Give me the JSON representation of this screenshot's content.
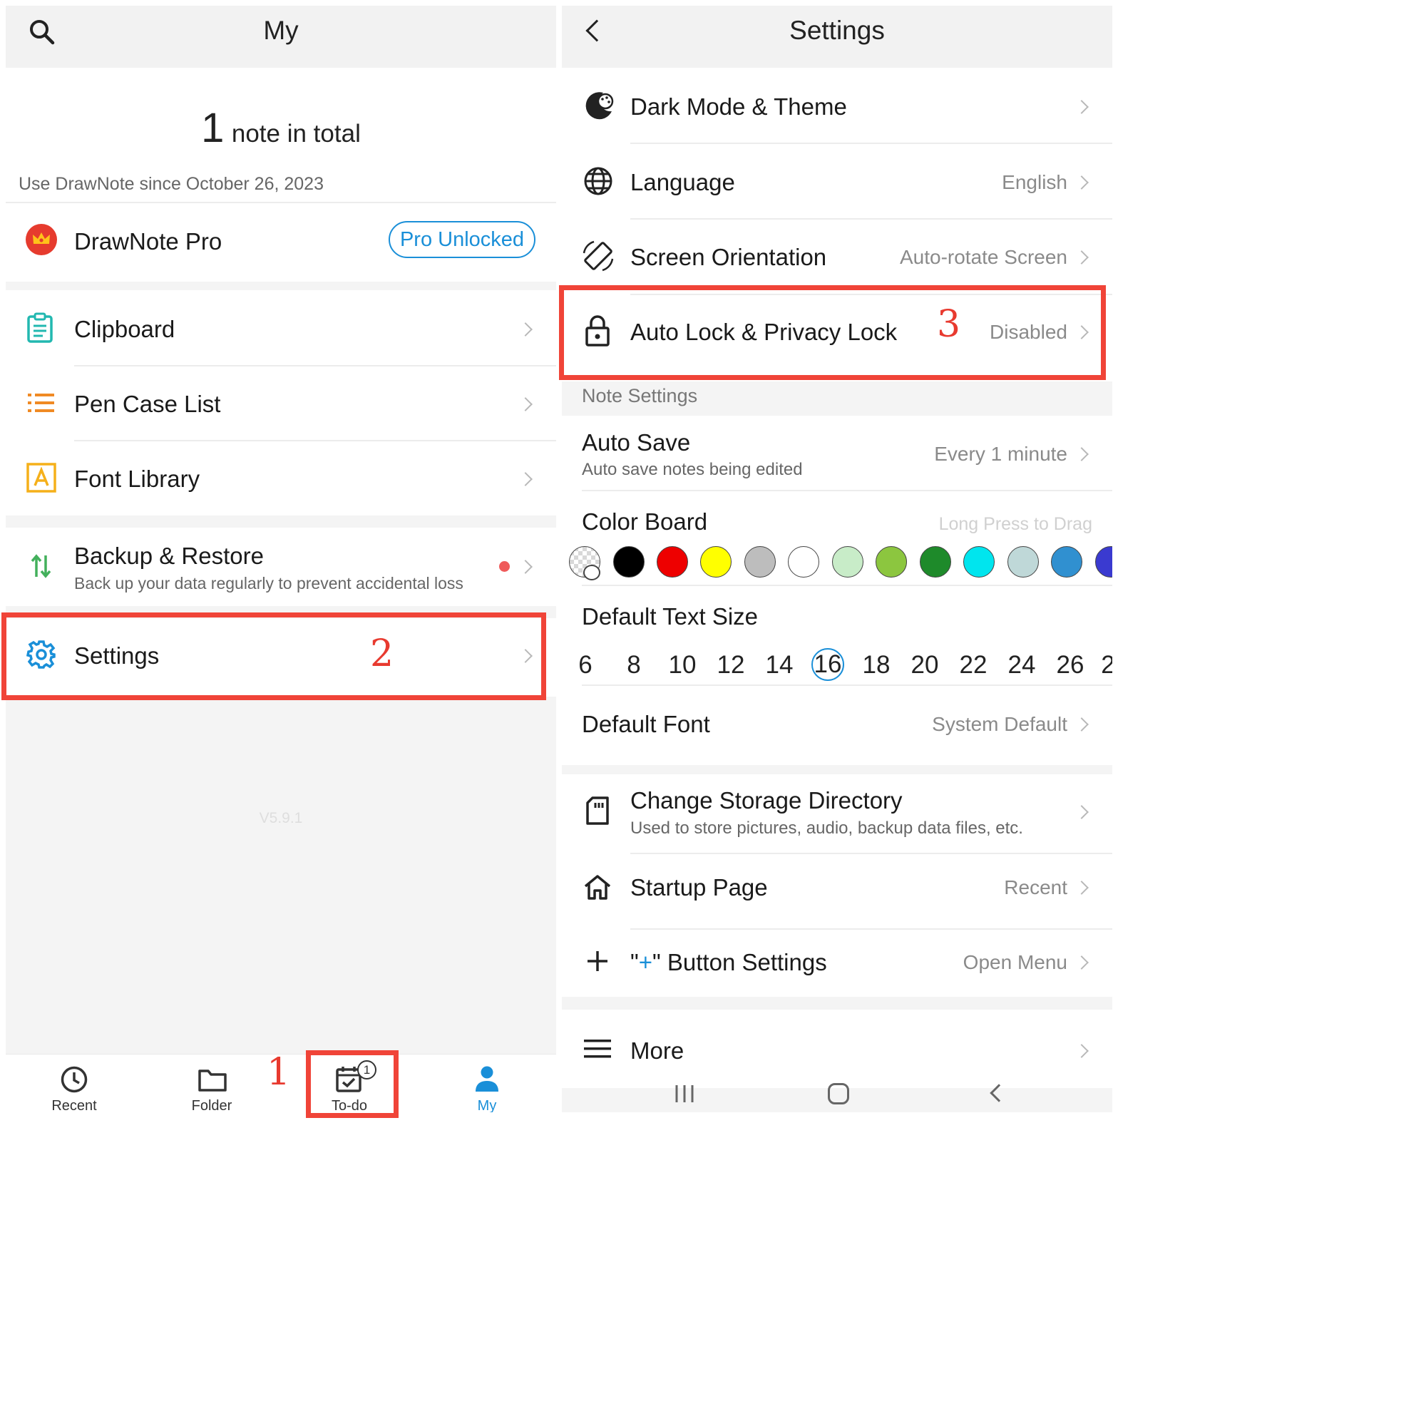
{
  "left": {
    "title": "My",
    "count_number": "1",
    "count_text": "note in total",
    "since": "Use DrawNote since October 26, 2023",
    "pro": {
      "label": "DrawNote Pro",
      "badge": "Pro Unlocked"
    },
    "menu": [
      {
        "label": "Clipboard",
        "icon": "clipboard-icon"
      },
      {
        "label": "Pen Case List",
        "icon": "list-icon"
      },
      {
        "label": "Font Library",
        "icon": "font-icon"
      }
    ],
    "backup": {
      "label": "Backup & Restore",
      "sub": "Back up your data regularly to prevent accidental loss"
    },
    "settings": {
      "label": "Settings",
      "icon": "gear-icon"
    },
    "version": "V5.9.1",
    "tabs": [
      {
        "label": "Recent",
        "icon": "clock-icon"
      },
      {
        "label": "Folder",
        "icon": "folder-icon"
      },
      {
        "label": "To-do",
        "icon": "calendar-check-icon",
        "badge": "1"
      },
      {
        "label": "My",
        "icon": "person-icon"
      }
    ]
  },
  "right": {
    "title": "Settings",
    "rows": [
      {
        "label": "Dark Mode & Theme",
        "value": "",
        "icon": "palette-moon-icon"
      },
      {
        "label": "Language",
        "value": "English",
        "icon": "globe-icon"
      },
      {
        "label": "Screen Orientation",
        "value": "Auto-rotate Screen",
        "icon": "rotate-icon"
      },
      {
        "label": "Auto Lock & Privacy Lock",
        "value": "Disabled",
        "icon": "lock-icon"
      }
    ],
    "note_settings_header": "Note Settings",
    "auto_save": {
      "label": "Auto Save",
      "sub": "Auto save notes being edited",
      "value": "Every 1 minute"
    },
    "color_board": {
      "label": "Color Board",
      "hint": "Long Press to Drag"
    },
    "colors": [
      "#000000",
      "#ee0000",
      "#ffff00",
      "#bdbdbd",
      "#ffffff",
      "#c8ecc8",
      "#8cc63f",
      "#1e8a2a",
      "#00e5ee",
      "#bfd8d8",
      "#3090d0",
      "#3a3ad0"
    ],
    "text_size": {
      "label": "Default Text Size",
      "sizes": [
        "6",
        "8",
        "10",
        "12",
        "14",
        "16",
        "18",
        "20",
        "22",
        "24",
        "26",
        "2"
      ],
      "selected": "16"
    },
    "default_font": {
      "label": "Default Font",
      "value": "System Default"
    },
    "storage": {
      "label": "Change Storage Directory",
      "sub": "Used to store pictures, audio, backup data files, etc."
    },
    "startup": {
      "label": "Startup Page",
      "value": "Recent"
    },
    "plus_button": {
      "q_open": "\"",
      "plus": "+",
      "q_close": "\"",
      "label": " Button Settings",
      "value": "Open Menu"
    },
    "more": {
      "label": "More"
    }
  },
  "annotations": {
    "step1": "1",
    "step2": "2",
    "step3": "3"
  },
  "accent": "#1a8fd8",
  "highlight": "#f04438"
}
